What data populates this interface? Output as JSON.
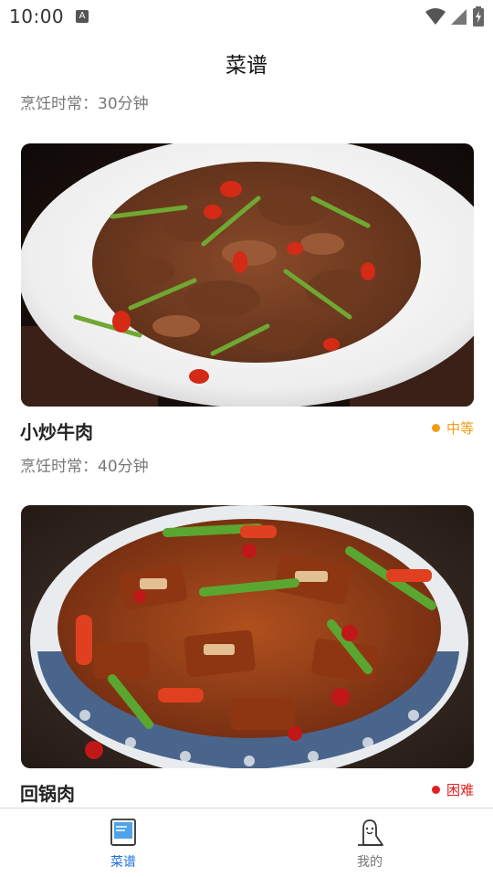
{
  "status_bar": {
    "time": "10:00",
    "notification_icon": "A",
    "icons": [
      "wifi-icon",
      "signal-icon",
      "battery-icon"
    ]
  },
  "header": {
    "title": "菜谱"
  },
  "list": {
    "top_partial_meta": "烹饪时常：30分钟",
    "items": [
      {
        "name": "小炒牛肉",
        "difficulty": "中等",
        "difficulty_color": "#f39c12",
        "time": "烹饪时常：40分钟",
        "image": "stir-fried-beef-photo"
      },
      {
        "name": "回锅肉",
        "difficulty": "困难",
        "difficulty_color": "#e02020",
        "time": "",
        "image": "twice-cooked-pork-photo"
      }
    ]
  },
  "tab_bar": {
    "active_color": "#1e6fd9",
    "tabs": [
      {
        "label": "菜谱",
        "icon": "recipe-book-icon",
        "active": true
      },
      {
        "label": "我的",
        "icon": "profile-icon",
        "active": false
      }
    ]
  }
}
